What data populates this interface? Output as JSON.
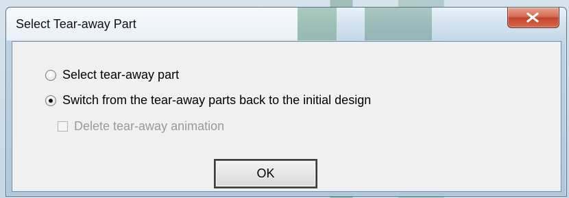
{
  "window": {
    "title": "Select Tear-away Part",
    "close_icon": "close-icon"
  },
  "options": {
    "select_label": "Select tear-away part",
    "switch_label": "Switch from the tear-away parts back to the initial design",
    "selected": "switch"
  },
  "checkbox": {
    "label": "Delete tear-away animation",
    "checked": false,
    "enabled": false
  },
  "buttons": {
    "ok_label": "OK"
  }
}
